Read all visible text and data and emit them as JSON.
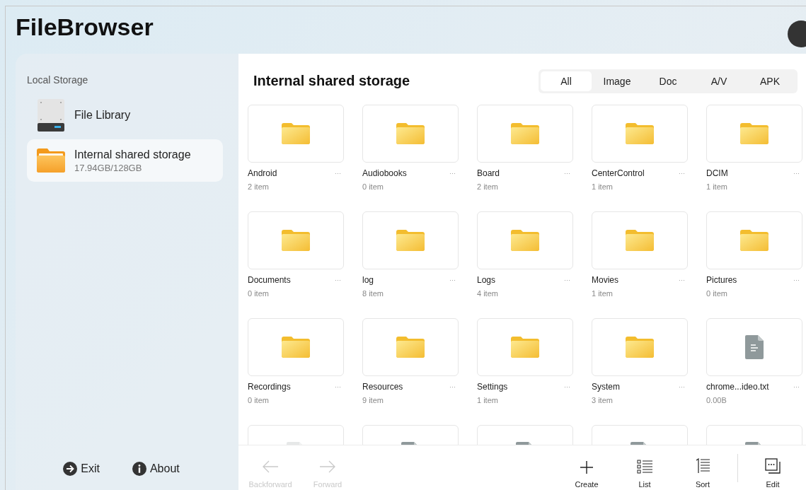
{
  "app": {
    "title": "FileBrowser"
  },
  "sidebar": {
    "section": "Local Storage",
    "items": [
      {
        "kind": "drive",
        "label": "File Library",
        "selected": false
      },
      {
        "kind": "folder",
        "label": "Internal shared storage",
        "detail": "17.94GB/128GB",
        "selected": true
      }
    ],
    "footer": [
      {
        "kind": "exit",
        "label": "Exit"
      },
      {
        "kind": "about",
        "label": "About"
      }
    ]
  },
  "main": {
    "title": "Internal shared storage",
    "filter_tabs": [
      {
        "label": "All",
        "selected": true
      },
      {
        "label": "Image",
        "selected": false
      },
      {
        "label": "Doc",
        "selected": false
      },
      {
        "label": "A/V",
        "selected": false
      },
      {
        "label": "APK",
        "selected": false
      }
    ],
    "items": [
      {
        "kind": "folder",
        "name": "Android",
        "info": "2 item",
        "more": "···"
      },
      {
        "kind": "folder",
        "name": "Audiobooks",
        "info": "0 item",
        "more": "···"
      },
      {
        "kind": "folder",
        "name": "Board",
        "info": "2 item",
        "more": "···"
      },
      {
        "kind": "folder",
        "name": "CenterControl",
        "info": "1 item",
        "more": "···"
      },
      {
        "kind": "folder",
        "name": "DCIM",
        "info": "1 item",
        "more": "···"
      },
      {
        "kind": "folder",
        "name": "Documents",
        "info": "0 item",
        "more": "···"
      },
      {
        "kind": "folder",
        "name": "log",
        "info": "8 item",
        "more": "···"
      },
      {
        "kind": "folder",
        "name": "Logs",
        "info": "4 item",
        "more": "···"
      },
      {
        "kind": "folder",
        "name": "Movies",
        "info": "1 item",
        "more": "···"
      },
      {
        "kind": "folder",
        "name": "Pictures",
        "info": "0 item",
        "more": "···"
      },
      {
        "kind": "folder",
        "name": "Recordings",
        "info": "0 item",
        "more": "···"
      },
      {
        "kind": "folder",
        "name": "Resources",
        "info": "9 item",
        "more": "···"
      },
      {
        "kind": "folder",
        "name": "Settings",
        "info": "1 item",
        "more": "···"
      },
      {
        "kind": "folder",
        "name": "System",
        "info": "3 item",
        "more": "···"
      },
      {
        "kind": "file",
        "name": "chrome...ideo.txt",
        "info": "0.00B",
        "more": "···"
      },
      {
        "kind": "blank-file"
      },
      {
        "kind": "file"
      },
      {
        "kind": "file"
      },
      {
        "kind": "file"
      },
      {
        "kind": "file"
      }
    ],
    "toolbar": [
      {
        "kind": "back",
        "label": "Backforward",
        "disabled": true
      },
      {
        "kind": "forward",
        "label": "Forward",
        "disabled": true
      },
      {
        "kind": "create",
        "label": "Create",
        "disabled": false
      },
      {
        "kind": "list",
        "label": "List",
        "disabled": false
      },
      {
        "kind": "sort",
        "label": "Sort",
        "disabled": false
      },
      {
        "kind": "edit",
        "label": "Edit",
        "disabled": false
      }
    ]
  }
}
